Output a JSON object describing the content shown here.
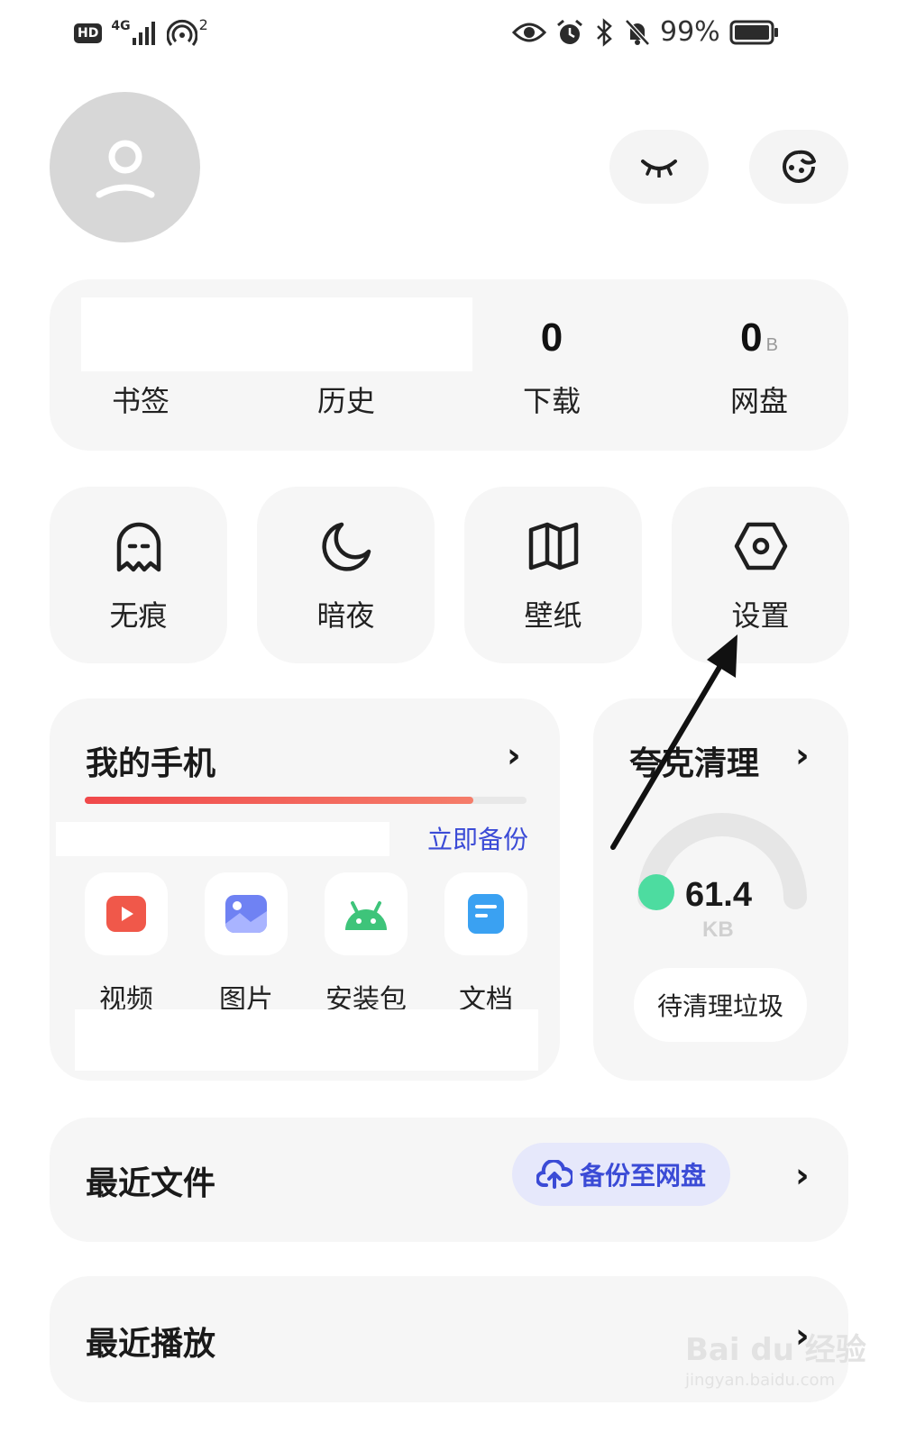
{
  "status_bar": {
    "hd_badge": "HD",
    "network": "4G",
    "hotspot_count": "2",
    "battery": "99%",
    "icons": [
      "signal-icon",
      "hotspot-icon",
      "eye-icon",
      "alarm-icon",
      "bluetooth-icon",
      "mute-icon",
      "battery-icon"
    ]
  },
  "header": {
    "avatar_icon": "user-icon",
    "buttons": [
      {
        "icon": "eye-closed-icon"
      },
      {
        "icon": "skin-face-icon"
      }
    ]
  },
  "stats": [
    {
      "label": "书签",
      "value": ""
    },
    {
      "label": "历史",
      "value": ""
    },
    {
      "label": "下载",
      "value": "0",
      "unit": ""
    },
    {
      "label": "网盘",
      "value": "0",
      "unit": "B"
    }
  ],
  "tools": [
    {
      "label": "无痕",
      "icon": "ghost-icon"
    },
    {
      "label": "暗夜",
      "icon": "moon-icon"
    },
    {
      "label": "壁纸",
      "icon": "wallpaper-icon"
    },
    {
      "label": "设置",
      "icon": "settings-hexagon-icon"
    }
  ],
  "my_phone": {
    "title": "我的手机",
    "storage_used_fraction": 0.88,
    "backup_link": "立即备份",
    "apps": [
      {
        "label": "视频",
        "icon": "video-icon",
        "color": "#f0584a"
      },
      {
        "label": "图片",
        "icon": "image-icon",
        "color": "#5a73ee"
      },
      {
        "label": "安装包",
        "icon": "android-icon",
        "color": "#3ec47a"
      },
      {
        "label": "文档",
        "icon": "document-icon",
        "color": "#3aa1f2"
      }
    ]
  },
  "cleaner": {
    "title": "夸克清理",
    "value": "61.4",
    "unit": "KB",
    "button": "待清理垃圾",
    "accent": "#4ddca0"
  },
  "recent_files": {
    "title": "最近文件",
    "backup_button": "备份至网盘",
    "icon": "cloud-upload-icon"
  },
  "recent_play": {
    "title": "最近播放"
  },
  "watermark": {
    "brand": "Bai du 经验",
    "url": "jingyan.baidu.com"
  },
  "colors": {
    "card_bg": "#f6f6f6",
    "progress_red": "#f0584a",
    "link_blue": "#3b4bd6"
  }
}
